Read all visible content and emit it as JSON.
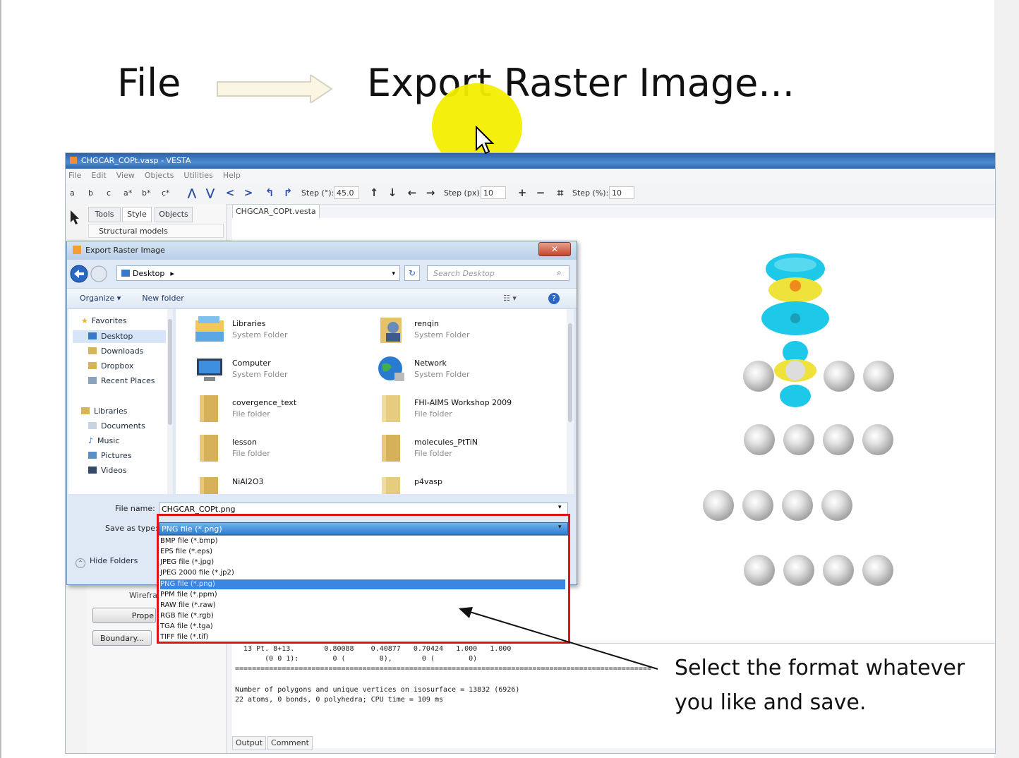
{
  "slide": {
    "step_from": "File",
    "step_to": "Export Raster Image...",
    "note_line1": "Select the format whatever",
    "note_line2": "you like and save."
  },
  "app": {
    "window_title": "CHGCAR_COPt.vasp - VESTA",
    "menu": [
      "File",
      "Edit",
      "View",
      "Objects",
      "Utilities",
      "Help"
    ],
    "toolbar": {
      "axis_labels": [
        "a",
        "b",
        "c",
        "a*",
        "b*",
        "c*"
      ],
      "step_deg_label": "Step (°):",
      "step_deg_value": "45.0",
      "step_px_label": "Step (px):",
      "step_px_value": "10",
      "step_pct_label": "Step (%):",
      "step_pct_value": "10"
    },
    "side_tabs": [
      "Tools",
      "Style",
      "Objects"
    ],
    "side_section": "Structural models",
    "side_buttons": [
      "Prope",
      "Boundary..."
    ],
    "side_partial": "Wireframe",
    "document_tab": "CHGCAR_COPt.vesta",
    "output_lines": [
      "  13 Pt. 8+13.       0.80088    0.40877   0.70424   1.000   1.000",
      "       (0 0 1):        0 (        0),       0 (        0)",
      "==================================================================================================",
      "",
      "Number of polygons and unique vertices on isosurface = 13832 (6926)",
      "22 atoms, 0 bonds, 0 polyhedra; CPU time = 109 ms"
    ],
    "bottom_tabs": [
      "Output",
      "Comment"
    ]
  },
  "dialog": {
    "title": "Export Raster Image",
    "close": "✕",
    "address": "Desktop",
    "search_placeholder": "Search Desktop",
    "organize": "Organize ▾",
    "new_folder": "New folder",
    "nav": {
      "favorites_header": "Favorites",
      "favorites": [
        "Desktop",
        "Downloads",
        "Dropbox",
        "Recent Places"
      ],
      "libraries_header": "Libraries",
      "libraries": [
        "Documents",
        "Music",
        "Pictures",
        "Videos"
      ]
    },
    "files": [
      {
        "name": "Libraries",
        "type": "System Folder"
      },
      {
        "name": "renqin",
        "type": "System Folder"
      },
      {
        "name": "Computer",
        "type": "System Folder"
      },
      {
        "name": "Network",
        "type": "System Folder"
      },
      {
        "name": "covergence_text",
        "type": "File folder"
      },
      {
        "name": "FHI-AIMS Workshop 2009",
        "type": "File folder"
      },
      {
        "name": "lesson",
        "type": "File folder"
      },
      {
        "name": "molecules_PtTiN",
        "type": "File folder"
      },
      {
        "name": "NiAl2O3",
        "type": ""
      },
      {
        "name": "p4vasp",
        "type": ""
      }
    ],
    "file_name_label": "File name:",
    "file_name_value": "CHGCAR_COPt.png",
    "save_type_label": "Save as type:",
    "save_type_value": "PNG file (*.png)",
    "hide_folders": "Hide Folders",
    "type_options": [
      "BMP file (*.bmp)",
      "EPS file (*.eps)",
      "JPEG file (*.jpg)",
      "JPEG 2000 file (*.jp2)",
      "PNG file (*.png)",
      "PPM file (*.ppm)",
      "RAW file (*.raw)",
      "RGB file (*.rgb)",
      "TGA file (*.tga)",
      "TIFF file (*.tif)"
    ],
    "selected_option": "PNG file (*.png)"
  },
  "colors": {
    "highlight": "#f4ee00",
    "red_box": "#e0121a",
    "isosurface_cyan": "#1fc7e6",
    "isosurface_yellow": "#f0e53a"
  }
}
